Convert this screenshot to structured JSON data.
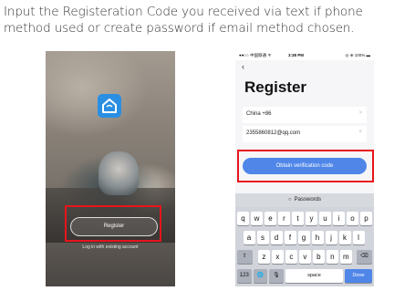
{
  "instruction": {
    "line1": "Input the Registeration Code you received via text if phone",
    "line2": "method used or create password if email method chosen."
  },
  "left_screen": {
    "logo_icon": "home-icon",
    "brand_color": "#2a8fe3",
    "register_label": "Register",
    "login_link": "Log in with existing account"
  },
  "right_screen": {
    "status": {
      "carrier": "●●○○ 中国联通 ᯤ",
      "time": "3:38 PM",
      "battery": "◎ ⊕ 100% ▬"
    },
    "back_icon": "chevron-left-icon",
    "title": "Register",
    "country_field": {
      "value": "China +86",
      "tail": ">"
    },
    "email_field": {
      "value": "2355860812@qq.com",
      "tail": "×"
    },
    "obtain_button": "Obtain verification code",
    "accent_color": "#4f86e8",
    "keyboard": {
      "suggestion": "Passwords",
      "row1": [
        "q",
        "w",
        "e",
        "r",
        "t",
        "y",
        "u",
        "i",
        "o",
        "p"
      ],
      "row2": [
        "a",
        "s",
        "d",
        "f",
        "g",
        "h",
        "j",
        "k",
        "l"
      ],
      "row3": [
        "z",
        "x",
        "c",
        "v",
        "b",
        "n",
        "m"
      ],
      "shift": "⇧",
      "backspace": "⌫",
      "numbers": "123",
      "globe": "🌐",
      "mic": "🎙",
      "space": "space",
      "done": "Done"
    }
  },
  "highlight_color": "#e8141b"
}
